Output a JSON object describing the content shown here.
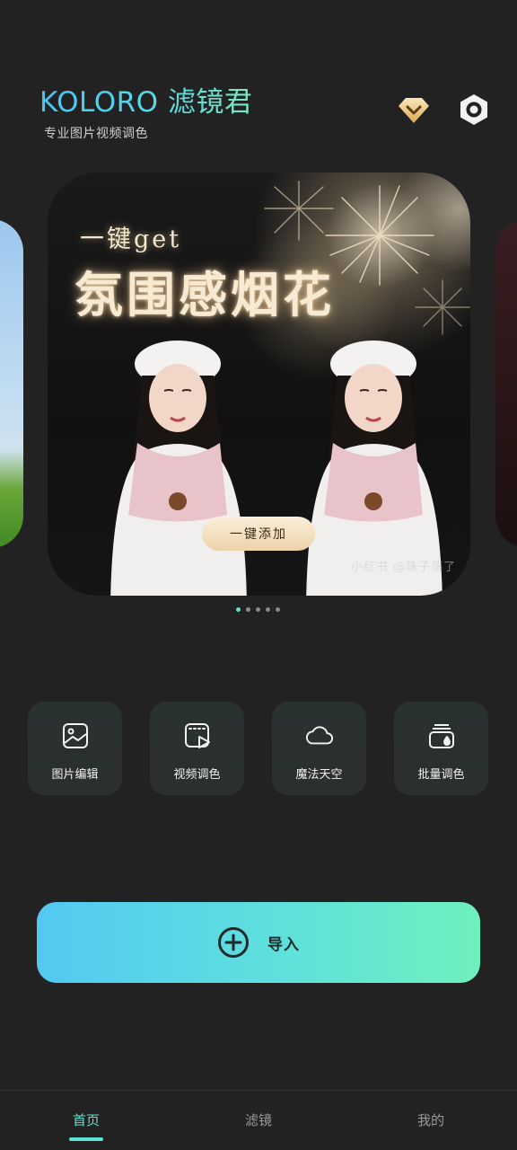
{
  "header": {
    "title": "KOLORO 滤镜君",
    "subtitle": "专业图片视频调色",
    "vip_icon": "vip-diamond-icon",
    "settings_icon": "hexagon-gear-icon"
  },
  "banner": {
    "kicker": "一键get",
    "headline": "氛围感烟花",
    "button_label": "一键添加",
    "watermark": "小红书 @珠子落了",
    "page_count": 5,
    "active_page": 1
  },
  "tools": [
    {
      "label": "图片编辑",
      "icon": "image-edit-icon"
    },
    {
      "label": "视频调色",
      "icon": "video-grade-icon"
    },
    {
      "label": "魔法天空",
      "icon": "cloud-icon"
    },
    {
      "label": "批量调色",
      "icon": "batch-grade-icon"
    }
  ],
  "import": {
    "label": "导入",
    "icon": "plus-circle-icon"
  },
  "nav": [
    {
      "label": "首页",
      "active": true
    },
    {
      "label": "滤镜",
      "active": false
    },
    {
      "label": "我的",
      "active": false
    }
  ],
  "colors": {
    "accent": "#5fe0d0",
    "background": "#222222",
    "card": "#2a3230"
  }
}
